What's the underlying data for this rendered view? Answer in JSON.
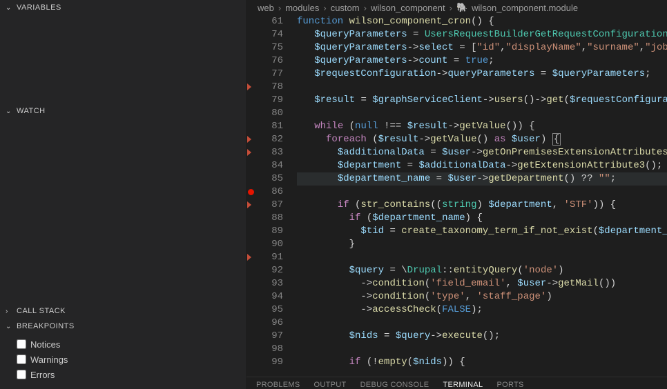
{
  "sidebar": {
    "variables_label": "VARIABLES",
    "watch_label": "WATCH",
    "callstack_label": "CALL STACK",
    "breakpoints_label": "BREAKPOINTS",
    "bp_items": [
      "Notices",
      "Warnings",
      "Errors"
    ]
  },
  "breadcrumbs": {
    "items": [
      "web",
      "modules",
      "custom",
      "wilson_component",
      "wilson_component.module"
    ]
  },
  "code": {
    "line_numbers": [
      61,
      74,
      75,
      76,
      77,
      78,
      79,
      80,
      81,
      82,
      83,
      84,
      85,
      86,
      87,
      88,
      89,
      90,
      91,
      92,
      93,
      94,
      95,
      96,
      97,
      98,
      99
    ],
    "glyphs": {
      "78": "marker",
      "82": "marker",
      "83": "marker",
      "86": "breakpoint",
      "87": "marker",
      "91": "marker"
    },
    "current_line": 85,
    "l61_fn": "function",
    "l61_name": "wilson_component_cron",
    "l74_v": "$queryParameters",
    "l74_cls": "UsersRequestBuilderGetRequestConfiguration:",
    "l75_s1": "\"id\"",
    "l75_s2": "\"displayName\"",
    "l75_s3": "\"surname\"",
    "l75_s4": "\"jobT",
    "l76_true": "true",
    "l77_v1": "$requestConfiguration",
    "l77_m": "queryParameters",
    "l79_v1": "$result",
    "l79_v2": "$graphServiceClient",
    "l79_m1": "users",
    "l79_m2": "get",
    "l79_v3": "$requestConfigurat",
    "l81_k": "while",
    "l81_null": "null",
    "l81_m": "getValue",
    "l82_k": "foreach",
    "l82_as": "as",
    "l82_u": "$user",
    "l83_v": "$additionalData",
    "l83_m": "getOnPremisesExtensionAttributes",
    "l84_v": "$department",
    "l84_m": "getExtensionAttribute3",
    "l85_v": "$department_name",
    "l85_m": "getDepartment",
    "l85_s": "\"\"",
    "l87_k": "if",
    "l87_fn": "str_contains",
    "l87_cast": "string",
    "l87_s": "'STF'",
    "l88_k": "if",
    "l89_v": "$tid",
    "l89_fn": "create_taxonomy_term_if_not_exist",
    "l89_arg": "$department_na",
    "l92_v": "$query",
    "l92_cls": "Drupal",
    "l92_m": "entityQuery",
    "l92_s": "'node'",
    "l93_m": "condition",
    "l93_s": "'field_email'",
    "l93_m2": "getMail",
    "l94_s1": "'type'",
    "l94_s2": "'staff_page'",
    "l95_m": "accessCheck",
    "l95_c": "FALSE",
    "l97_v": "$nids",
    "l97_m": "execute",
    "l99_k": "if",
    "l99_fn": "empty"
  },
  "bottom_tabs": {
    "items": [
      "PROBLEMS",
      "OUTPUT",
      "DEBUG CONSOLE",
      "TERMINAL",
      "PORTS"
    ],
    "active": "TERMINAL"
  }
}
